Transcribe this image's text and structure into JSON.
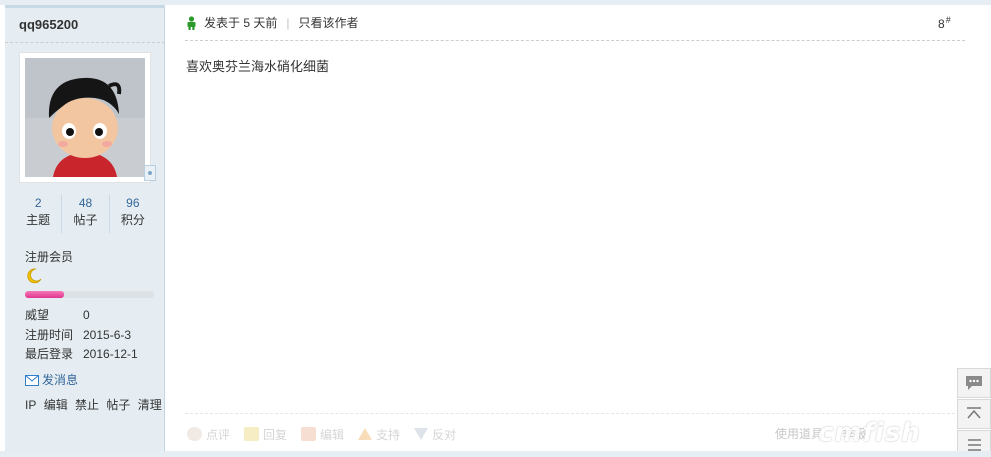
{
  "author": {
    "username": "qq965200",
    "stats": [
      {
        "value": "2",
        "label": "主题"
      },
      {
        "value": "48",
        "label": "帖子"
      },
      {
        "value": "96",
        "label": "积分"
      }
    ],
    "group": "注册会员",
    "level_progress_pct": 30,
    "info": [
      {
        "key": "威望",
        "value": "0"
      },
      {
        "key": "注册时间",
        "value": "2015-6-3"
      },
      {
        "key": "最后登录",
        "value": "2016-12-1"
      }
    ],
    "send_message": "发消息",
    "admin_links": [
      "IP",
      "编辑",
      "禁止",
      "帖子",
      "清理"
    ]
  },
  "post": {
    "posted_text": "发表于 5 天前",
    "author_only": "只看该作者",
    "floor": "8",
    "floor_suffix": "#",
    "content": "喜欢奥芬兰海水硝化细菌"
  },
  "actions": {
    "comment": "点评",
    "reply": "回复",
    "edit": "编辑",
    "support": "支持",
    "oppose": "反对",
    "tools": [
      "使用道具",
      "举报"
    ]
  },
  "watermark": "cmfish"
}
